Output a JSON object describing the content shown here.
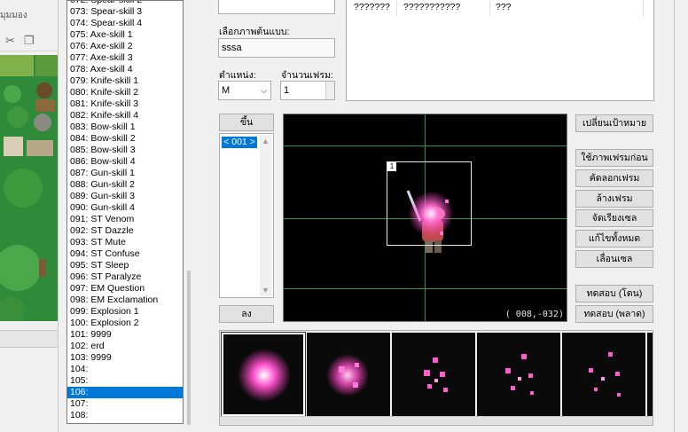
{
  "left_strip": {
    "title": "มุมมอง",
    "toolbar": [
      "cut-icon",
      "copy-icon"
    ]
  },
  "animation_list": {
    "items": [
      "072: Spear-skill 2",
      "073: Spear-skill 3",
      "074: Spear-skill 4",
      "075: Axe-skill 1",
      "076: Axe-skill 2",
      "077: Axe-skill 3",
      "078: Axe-skill 4",
      "079: Knife-skill 1",
      "080: Knife-skill 2",
      "081: Knife-skill 3",
      "082: Knife-skill 4",
      "083: Bow-skill 1",
      "084: Bow-skill 2",
      "085: Bow-skill 3",
      "086: Bow-skill 4",
      "087: Gun-skill 1",
      "088: Gun-skill 2",
      "089: Gun-skill 3",
      "090: Gun-skill 4",
      "091: ST Venom",
      "092: ST Dazzle",
      "093: ST Mute",
      "094: ST Confuse",
      "095: ST Sleep",
      "096: ST Paralyze",
      "097: EM Question",
      "098: EM Exclamation",
      "099: Explosion 1",
      "100: Explosion 2",
      "101: 9999",
      "102: erd",
      "103: 9999",
      "104:",
      "105:",
      "106:",
      "107:",
      "108:"
    ],
    "selected": "106:"
  },
  "target_table": {
    "col1": "???????",
    "col2": "???????????",
    "col3": "???"
  },
  "image_name": {
    "label": "เลือกภาพต้นแบบ:",
    "value": "sssa"
  },
  "position": {
    "label": "ตำแหน่ง:",
    "value": "M"
  },
  "frame_count": {
    "label": "จำนวนเฟรม:",
    "value": "1"
  },
  "frame_list": {
    "up_label": "ขึ้น",
    "down_label": "ลง",
    "selected_frame": "< 001 >"
  },
  "canvas": {
    "coord": "( 008,-032)",
    "cell_index": "1"
  },
  "buttons": {
    "change_target": "เปลี่ยนเป้าหมาย",
    "use_prev_frame": "ใช้ภาพเฟรมก่อน",
    "copy_frame": "คัดลอกเฟรม",
    "clear_frame": "ล้างเฟรม",
    "arrange_cells": "จัดเรียงเซล",
    "batch_edit": "แก้ไขทั้งหมด",
    "shift_cells": "เลื่อนเซล",
    "test_hit": "ทดสอบ (โดน)",
    "test_miss": "ทดสอบ (พลาด)"
  },
  "colors": {
    "selection": "#0078d7",
    "guide": "#3a8f3a",
    "effect": "#ff4fc8"
  }
}
